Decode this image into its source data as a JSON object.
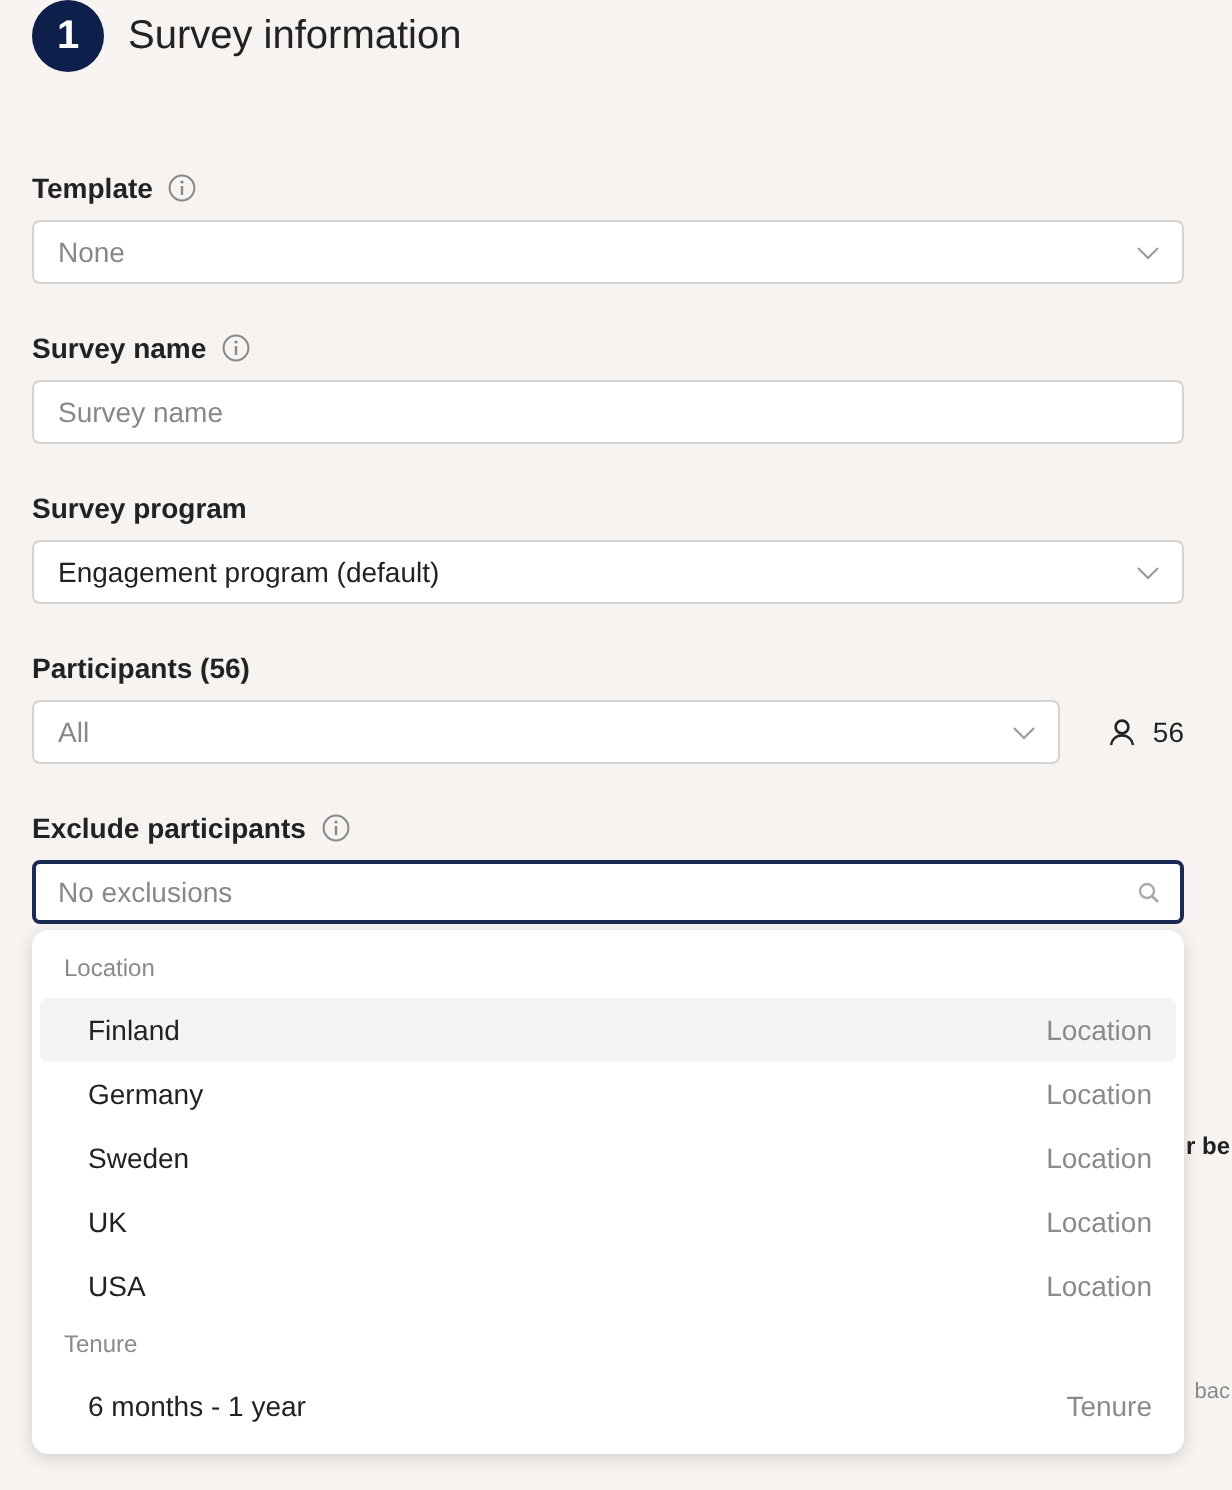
{
  "section": {
    "number": "1",
    "title": "Survey information"
  },
  "fields": [
    {
      "kind": "select",
      "label": "Template",
      "info": true,
      "placeholder": "None"
    },
    {
      "kind": "text",
      "label": "Survey name",
      "info": true,
      "placeholder": "Survey name"
    },
    {
      "kind": "select",
      "label": "Survey program",
      "info": false,
      "value": "Engagement program (default)"
    },
    {
      "kind": "select",
      "label": "Participants (56)",
      "info": false,
      "placeholder": "All",
      "count": "56"
    },
    {
      "kind": "search",
      "label": "Exclude participants",
      "info": true,
      "placeholder": "No exclusions",
      "focused": true
    }
  ],
  "dropdown": {
    "groups": [
      {
        "title": "Location",
        "items": [
          {
            "label": "Finland",
            "category": "Location",
            "highlighted": true
          },
          {
            "label": "Germany",
            "category": "Location",
            "highlighted": false
          },
          {
            "label": "Sweden",
            "category": "Location",
            "highlighted": false
          },
          {
            "label": "UK",
            "category": "Location",
            "highlighted": false
          },
          {
            "label": "USA",
            "category": "Location",
            "highlighted": false
          }
        ]
      },
      {
        "title": "Tenure",
        "items": [
          {
            "label": "6 months - 1 year",
            "category": "Tenure",
            "highlighted": false
          }
        ]
      }
    ]
  },
  "behind_texts": [
    {
      "kind": "heading",
      "text": "r be"
    },
    {
      "kind": "hint",
      "text": "bac"
    }
  ]
}
